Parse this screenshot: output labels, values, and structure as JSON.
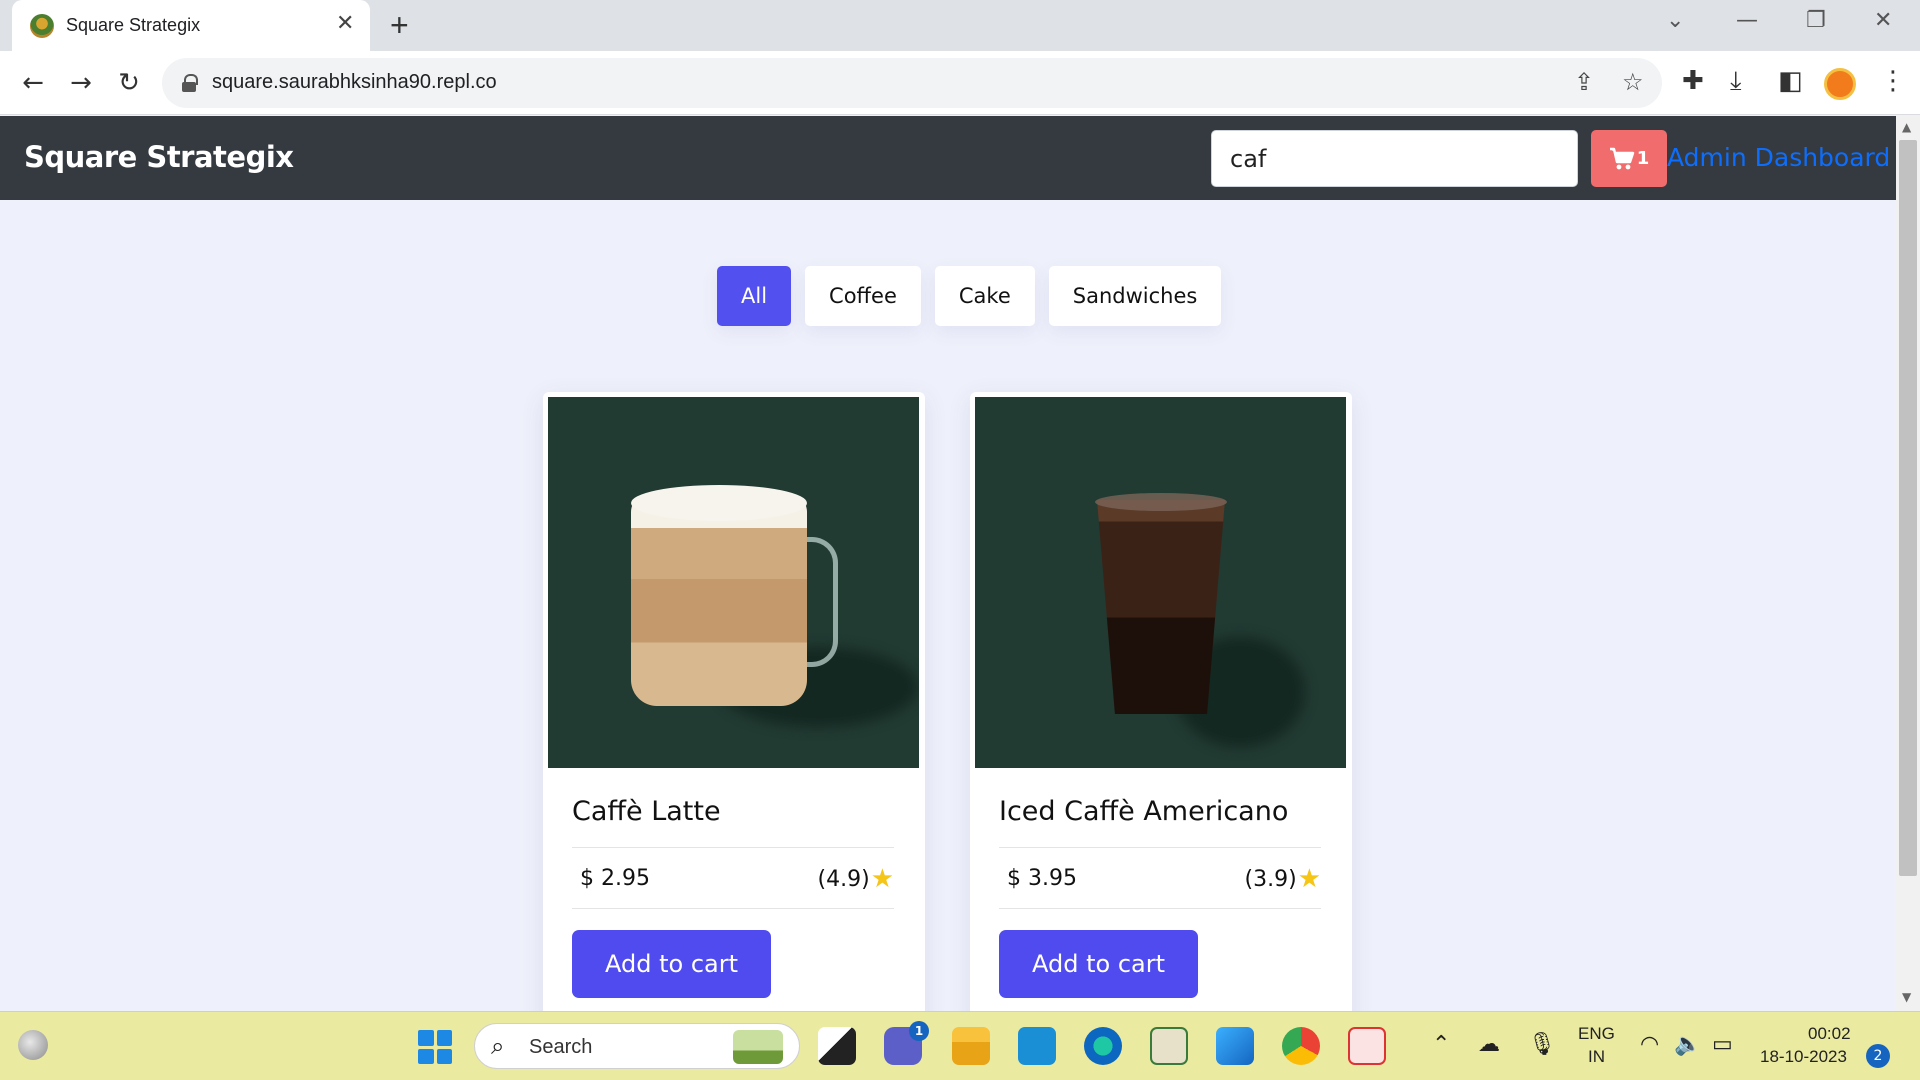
{
  "browser": {
    "tab_title": "Square Strategix",
    "url": "square.saurabhksinha90.repl.co"
  },
  "navbar": {
    "brand": "Square Strategix",
    "search_value": "caf",
    "cart_count": "1",
    "admin_link": "Admin Dashboard"
  },
  "filters": [
    {
      "label": "All",
      "active": true
    },
    {
      "label": "Coffee",
      "active": false
    },
    {
      "label": "Cake",
      "active": false
    },
    {
      "label": "Sandwiches",
      "active": false
    }
  ],
  "products": [
    {
      "name": "Caffè Latte",
      "price": "$ 2.95",
      "rating": "(4.9)",
      "button": "Add to cart"
    },
    {
      "name": "Iced Caffè Americano",
      "price": "$ 3.95",
      "rating": "(3.9)",
      "button": "Add to cart"
    }
  ],
  "taskbar": {
    "search_label": "Search",
    "chat_badge": "1",
    "lang_top": "ENG",
    "lang_bottom": "IN",
    "time": "00:02",
    "date": "18-10-2023",
    "notification_count": "2"
  },
  "colors": {
    "navbar_bg": "#343a40",
    "accent": "#5350f0",
    "cart_button": "#f16c6c",
    "admin_link": "#0d6efd",
    "star": "#f5c518"
  }
}
